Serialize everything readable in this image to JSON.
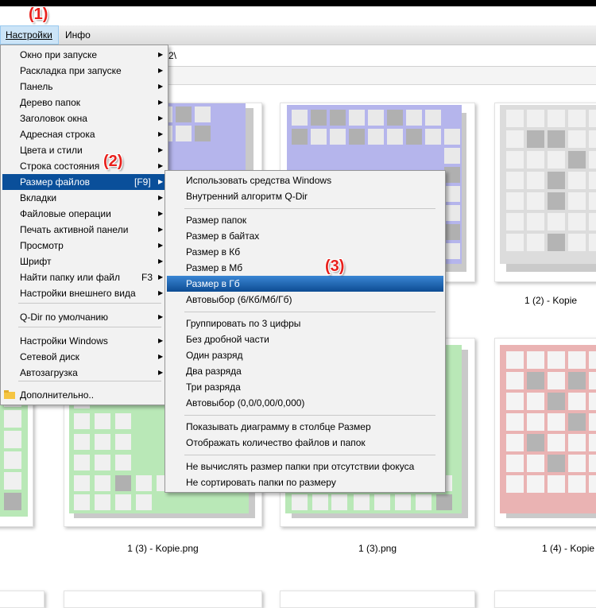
{
  "menubar": {
    "settings": "Настройки",
    "info": "Инфо"
  },
  "address": {
    "text": "2\\"
  },
  "badges": {
    "b1": "(1)",
    "b2": "(2)",
    "b3": "(3)"
  },
  "settings_menu": [
    {
      "label": "Окно при запуске",
      "arrow": "▶"
    },
    {
      "label": "Раскладка при запуске",
      "arrow": "▶"
    },
    {
      "label": "Панель",
      "arrow": "▶"
    },
    {
      "label": "Дерево папок",
      "arrow": "▶"
    },
    {
      "label": "Заголовок окна",
      "arrow": "▶"
    },
    {
      "label": "Адресная строка",
      "arrow": "▶"
    },
    {
      "label": "Цвета и стили",
      "arrow": "▶"
    },
    {
      "label": "Строка состояния",
      "arrow": "▶"
    },
    {
      "label": "Размер файлов",
      "shortcut": "[F9]",
      "arrow": "▶"
    },
    {
      "label": "Вкладки",
      "arrow": "▶"
    },
    {
      "label": "Файловые операции",
      "arrow": "▶"
    },
    {
      "label": "Печать активной панели",
      "arrow": "▶"
    },
    {
      "label": "Просмотр",
      "arrow": "▶"
    },
    {
      "label": "Шрифт",
      "arrow": "▶"
    },
    {
      "label": "Найти папку или файл",
      "shortcut": "F3",
      "arrow": "▶"
    },
    {
      "label": "Настройки внешнего вида",
      "arrow": "▶"
    },
    {
      "label": "Q-Dir по умолчанию",
      "arrow": "▶"
    },
    {
      "label": "Настройки Windows",
      "arrow": "▶"
    },
    {
      "label": "Сетевой диск",
      "arrow": "▶"
    },
    {
      "label": "Автозагрузка",
      "arrow": "▶"
    },
    {
      "label": "Дополнительно.."
    }
  ],
  "file_size_menu": [
    "Использовать средства Windows",
    "Внутренний алгоритм Q-Dir",
    "Размер папок",
    "Размер в байтах",
    "Размер в Кб",
    "Размер в Мб",
    "Размер в Гб",
    "Автовыбор (6/Кб/Мб/Гб)",
    "Группировать по 3 цифры",
    "Без дробной части",
    "Один разряд",
    "Два разряда",
    "Три разряда",
    "Автовыбор (0,0/0,00/0,000)",
    "Показывать диаграмму в столбце Размер",
    "Отображать количество файлов и папок",
    "Не вычислять размер папки при отсутствии фокуса",
    "Не сортировать папки по размеру"
  ],
  "captions": {
    "c1": "1 (2) - Kopie",
    "c2": "1 (3) - Kopie.png",
    "c3": "1 (3).png",
    "c4": "1 (4) - Kopie"
  },
  "colors": {
    "blue": "#b5b5ec",
    "grey": "#d3d3d3",
    "green": "#b9e8b7",
    "red": "#eab3b3",
    "highlight": "#0a4f9a",
    "badge": "#e8201c"
  }
}
